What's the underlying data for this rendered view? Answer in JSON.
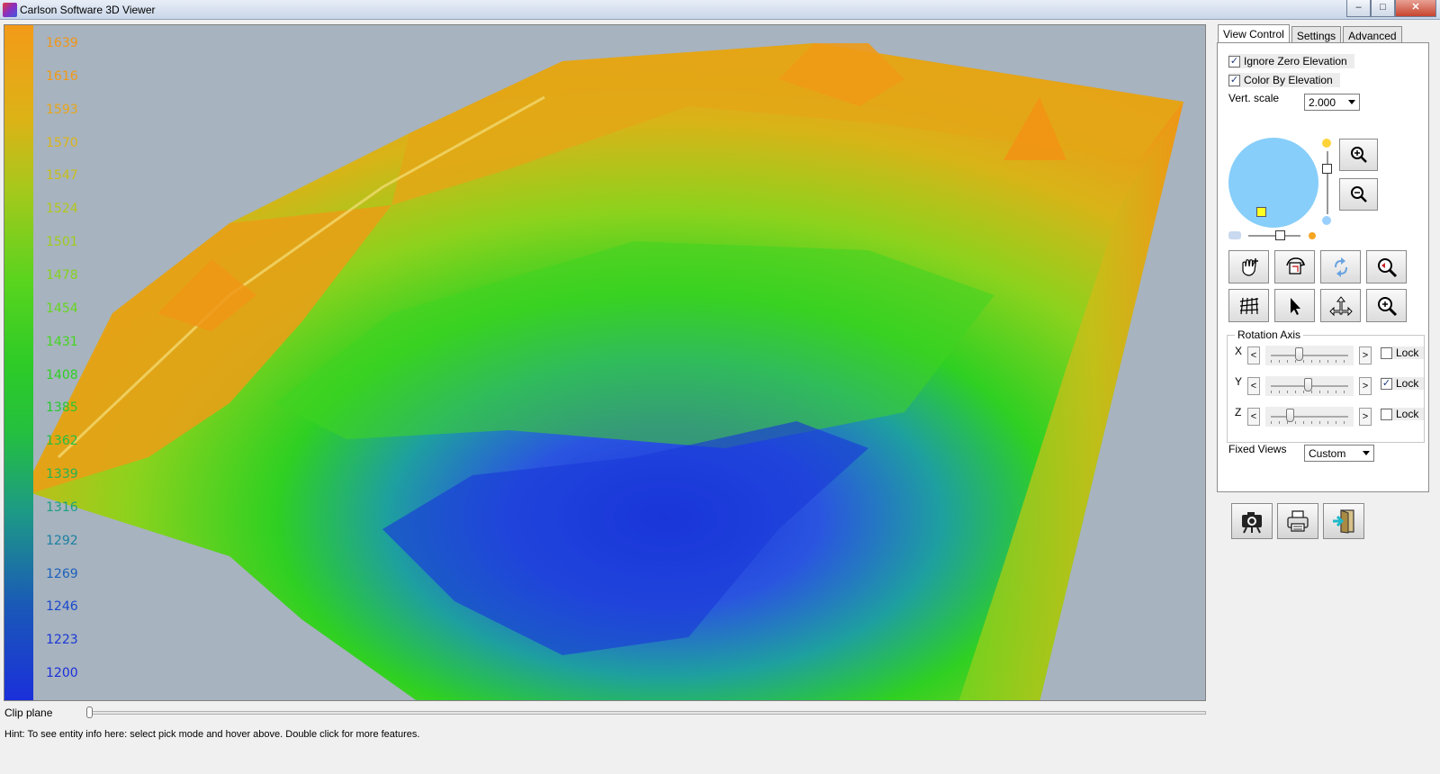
{
  "window": {
    "title": "Carlson Software 3D Viewer",
    "minimize_glyph": "–",
    "maximize_glyph": "□",
    "close_glyph": "✕"
  },
  "legend": {
    "labels": [
      "1639",
      "1616",
      "1593",
      "1570",
      "1547",
      "1524",
      "1501",
      "1478",
      "1454",
      "1431",
      "1408",
      "1385",
      "1362",
      "1339",
      "1316",
      "1292",
      "1269",
      "1246",
      "1223",
      "1200"
    ],
    "label_colors": [
      "#f29514",
      "#f29a16",
      "#e9a617",
      "#dcb317",
      "#c9be18",
      "#b4c71b",
      "#9fcd1c",
      "#86d21d",
      "#66d61e",
      "#44d61f",
      "#2fd022",
      "#28c830",
      "#23bf40",
      "#21b552",
      "#1d9e84",
      "#1b80a0",
      "#1b60bb",
      "#1a48cc",
      "#1a38d6",
      "#1a2fdb"
    ]
  },
  "tabs": [
    {
      "label": "View Control",
      "active": true
    },
    {
      "label": "Settings",
      "active": false
    },
    {
      "label": "Advanced",
      "active": false
    }
  ],
  "options": {
    "ignore_zero_elevation": {
      "label": "Ignore Zero Elevation",
      "checked": true
    },
    "color_by_elevation": {
      "label": "Color By Elevation",
      "checked": true
    },
    "vert_scale_label": "Vert. scale",
    "vert_scale_value": "2.000"
  },
  "rotation": {
    "title": "Rotation Axis",
    "lock_label": "Lock",
    "axes": [
      {
        "name": "X",
        "locked": false,
        "value": 0.35
      },
      {
        "name": "Y",
        "locked": true,
        "value": 0.48
      },
      {
        "name": "Z",
        "locked": false,
        "value": 0.22
      }
    ]
  },
  "fixed_views": {
    "label": "Fixed Views",
    "value": "Custom"
  },
  "clip_plane": {
    "label": "Clip plane",
    "value": 0.0
  },
  "hint": "Hint: To see entity info here: select pick mode and hover above. Double click for more features.",
  "icons": {
    "zoom_in": "zoom-in-icon",
    "zoom_out": "zoom-out-icon",
    "tools": [
      "pan-hand-icon",
      "rotate-view-icon",
      "orbit-icon",
      "zoom-window-icon",
      "mesh-icon",
      "pick-arrow-icon",
      "move-axis-icon",
      "zoom-extents-icon"
    ],
    "bottom": [
      "snapshot-camera-icon",
      "print-icon",
      "exit-door-icon"
    ]
  },
  "colors": {
    "viewport_bg": "#a7b3bf",
    "light_circle": "#87cefa",
    "light_marker": "#ffff20"
  }
}
